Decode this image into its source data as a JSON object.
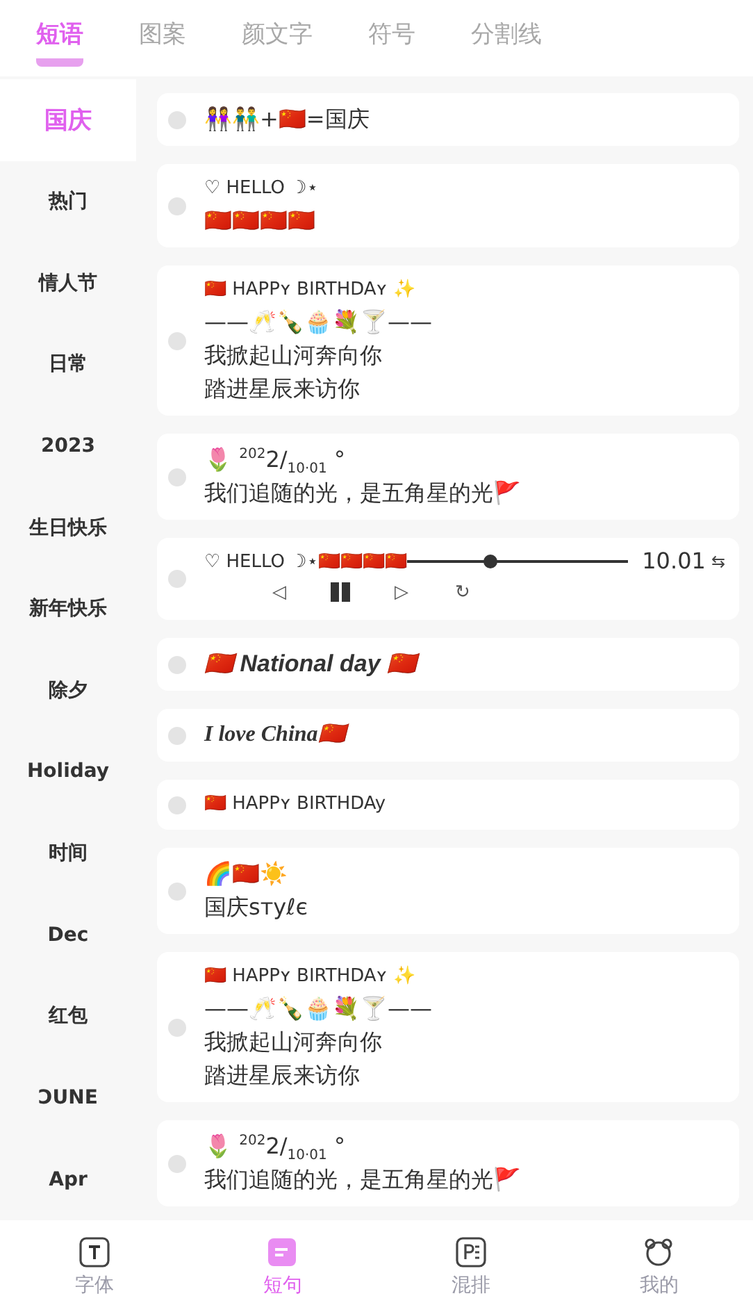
{
  "tabs": [
    {
      "label": "短语",
      "selected": true
    },
    {
      "label": "图案",
      "selected": false
    },
    {
      "label": "颜文字",
      "selected": false
    },
    {
      "label": "符号",
      "selected": false
    },
    {
      "label": "分割线",
      "selected": false
    }
  ],
  "sidebar": {
    "items": [
      {
        "label": "国庆",
        "selected": true
      },
      {
        "label": "热门",
        "selected": false
      },
      {
        "label": "情人节",
        "selected": false
      },
      {
        "label": "日常",
        "selected": false
      },
      {
        "label": "2023",
        "selected": false
      },
      {
        "label": "生日快乐",
        "selected": false
      },
      {
        "label": "新年快乐",
        "selected": false
      },
      {
        "label": "除夕",
        "selected": false
      },
      {
        "label": "Holiday",
        "selected": false
      },
      {
        "label": "时间",
        "selected": false
      },
      {
        "label": "Dec",
        "selected": false
      },
      {
        "label": "红包",
        "selected": false
      },
      {
        "label": "ƆUNE",
        "selected": false
      },
      {
        "label": "Apr",
        "selected": false
      }
    ]
  },
  "cards": [
    {
      "kind": "text",
      "checked": false,
      "lines": [
        {
          "text": "👭👬+🇨🇳=国庆",
          "kind": "plain"
        }
      ]
    },
    {
      "kind": "text",
      "checked": false,
      "lines": [
        {
          "text": "♡ HELLO ☽⋆",
          "kind": "circled"
        },
        {
          "text": "🇨🇳🇨🇳🇨🇳🇨🇳",
          "kind": "plain"
        }
      ]
    },
    {
      "kind": "text",
      "checked": false,
      "lines": [
        {
          "text": "🇨🇳 HAPPʏ  BIRTHDAʏ  ✨",
          "kind": "small"
        },
        {
          "text": "——🥂🍾🧁💐🍸——",
          "kind": "plain"
        },
        {
          "text": "我掀起山河奔向你",
          "kind": "plain"
        },
        {
          "text": "踏进星辰来访你",
          "kind": "plain"
        }
      ]
    },
    {
      "kind": "text",
      "checked": false,
      "lines": [
        {
          "text": "🌷 $^{202}$2/$_{10·01}$ °",
          "kind": "plain"
        },
        {
          "text": "我们追随的光，是五角星的光🚩",
          "kind": "plain"
        }
      ]
    },
    {
      "kind": "player",
      "checked": false,
      "text": "♡ HELLO ☽⋆🇨🇳🇨🇳🇨🇳🇨🇳",
      "level": 0.38,
      "reading": "10.01",
      "repeat": "⇆",
      "controls": [
        {
          "kind": "glyph",
          "text": "◁"
        },
        {
          "kind": "pause"
        },
        {
          "kind": "glyph",
          "text": "▷"
        },
        {
          "kind": "glyph",
          "text": "↻"
        }
      ]
    },
    {
      "kind": "text",
      "checked": false,
      "lines": [
        {
          "text": "🇨🇳 National day 🇨🇳",
          "kind": "bold"
        }
      ]
    },
    {
      "kind": "text",
      "checked": false,
      "lines": [
        {
          "text": "I love China🇨🇳",
          "kind": "serif"
        }
      ]
    },
    {
      "kind": "text",
      "checked": false,
      "lines": [
        {
          "text": "🇨🇳 HAPPʏ  BIRTHDAy",
          "kind": "small"
        }
      ]
    },
    {
      "kind": "text",
      "checked": false,
      "lines": [
        {
          "text": "🌈🇨🇳☀️",
          "kind": "plain"
        },
        {
          "text": "国庆ѕтуℓє",
          "kind": "plain"
        }
      ]
    },
    {
      "kind": "text",
      "checked": false,
      "lines": [
        {
          "text": "🇨🇳 HAPPʏ  BIRTHDAʏ  ✨",
          "kind": "small"
        },
        {
          "text": "——🥂🍾🧁💐🍸——",
          "kind": "plain"
        },
        {
          "text": "我掀起山河奔向你",
          "kind": "plain"
        },
        {
          "text": "踏进星辰来访你",
          "kind": "plain"
        }
      ]
    },
    {
      "kind": "text",
      "checked": false,
      "lines": [
        {
          "text": "🌷 $^{202}$2/$_{10·01}$ °",
          "kind": "plain"
        },
        {
          "text": "我们追随的光，是五角星的光🚩",
          "kind": "plain"
        }
      ]
    }
  ],
  "bottom_nav": [
    {
      "label": "字体",
      "kind": "font",
      "selected": false
    },
    {
      "label": "短句",
      "kind": "note",
      "selected": true
    },
    {
      "label": "混排",
      "kind": "mix",
      "selected": false
    },
    {
      "label": "我的",
      "kind": "profile",
      "selected": false
    }
  ]
}
